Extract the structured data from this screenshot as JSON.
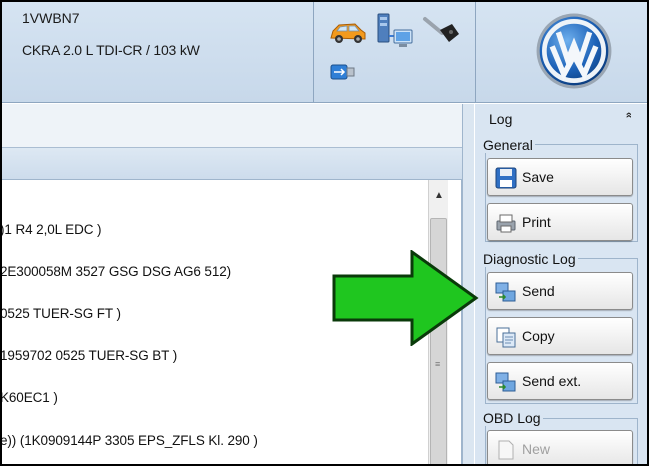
{
  "vehicle": {
    "vin": "1VWBN7",
    "engine": "CKRA 2.0 L TDI-CR / 103 kW"
  },
  "header_icons": [
    "car-icon",
    "network-icon",
    "key-icon",
    "usb-icon"
  ],
  "logo": "VW",
  "list_rows": [
    ")1   R4 2,0L EDC )",
    "2E300058M    3527  GSG DSG AG6    512)",
    "  0525  TUER-SG FT  )",
    "1959702    0525  TUER-SG BT  )",
    "K60EC1 )",
    "e)) (1K0909144P    3305  EPS_ZFLS Kl. 290  )"
  ],
  "sidebar": {
    "title": "Log",
    "collapse_glyph": "»",
    "groups": {
      "general": "General",
      "diagnostic_log": "Diagnostic Log",
      "obd_log": "OBD Log"
    },
    "buttons": {
      "save": "Save",
      "print": "Print",
      "send": "Send",
      "copy": "Copy",
      "send_ext": "Send ext.",
      "new": "New"
    }
  },
  "colors": {
    "header_bg": "#cfdeee",
    "sidebar_bg": "#d9e5f2",
    "arrow_green": "#1fc61f",
    "arrow_outline": "#0a3a0a"
  }
}
